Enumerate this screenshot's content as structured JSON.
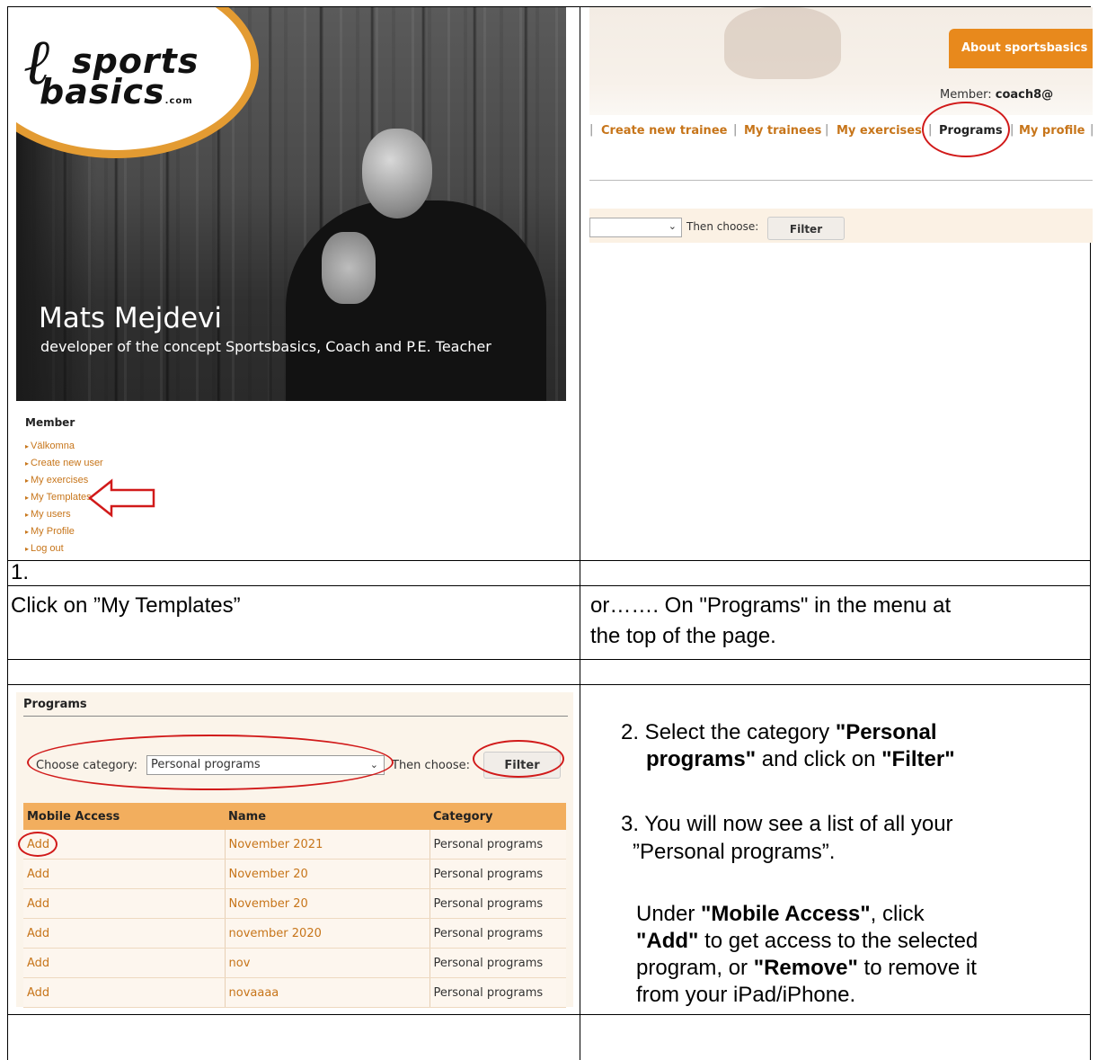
{
  "banner": {
    "logo_line1": "sports",
    "logo_line2": "basics",
    "logo_suffix": ".com",
    "name": "Mats Mejdevi",
    "role": "developer of the concept Sportsbasics, Coach and P.E. Teacher"
  },
  "member_menu": {
    "heading": "Member",
    "items": [
      "Välkomna",
      "Create new user",
      "My exercises",
      "My Templates",
      "My users",
      "My Profile",
      "Log out"
    ]
  },
  "header": {
    "about_tab": "About sportsbasics",
    "member_label": "Member:",
    "member_user": "coach8@",
    "nav": [
      "Create new trainee",
      "My trainees",
      "My exercises",
      "Programs",
      "My profile"
    ],
    "then_choose": "Then choose:",
    "filter": "Filter"
  },
  "cells": {
    "step1_number": "1.",
    "left_instruction": "Click on ”My Templates”",
    "right_instruction_line1": "or……. On \"Programs\" in the menu at",
    "right_instruction_line2": "the top of the page."
  },
  "programs": {
    "title": "Programs",
    "choose_category_label": "Choose category:",
    "category_value": "Personal programs",
    "then_choose": "Then choose:",
    "filter": "Filter",
    "columns": [
      "Mobile Access",
      "Name",
      "Category"
    ],
    "rows": [
      {
        "access": "Add",
        "name": "November 2021",
        "category": "Personal programs"
      },
      {
        "access": "Add",
        "name": "November 20",
        "category": "Personal programs"
      },
      {
        "access": "Add",
        "name": "November 20",
        "category": "Personal programs"
      },
      {
        "access": "Add",
        "name": "november 2020",
        "category": "Personal programs"
      },
      {
        "access": "Add",
        "name": "nov",
        "category": "Personal programs"
      },
      {
        "access": "Add",
        "name": "novaaaa",
        "category": "Personal programs"
      }
    ]
  },
  "instructions": {
    "step2_prefix": "2. Select the category ",
    "step2_bold1": "\"Personal",
    "step2_bold2": "programs\"",
    "step2_mid": " and click on ",
    "step2_bold3": "\"Filter\"",
    "step3_line1": "3. You will now see a list of all your",
    "step3_line2": "”Personal programs”.",
    "under": "Under ",
    "mobile_access": "\"Mobile Access\"",
    "click": ", click",
    "add": "\"Add\"",
    "to_get": " to get access to the selected",
    "program_or": "program, or ",
    "remove": "\"Remove\"",
    "to_remove": " to remove it",
    "from": "from your iPad/iPhone."
  },
  "colors": {
    "accent_orange": "#e8891c",
    "link_orange": "#c7751a",
    "annotation_red": "#d11a1a",
    "table_header": "#f2ae5e"
  }
}
